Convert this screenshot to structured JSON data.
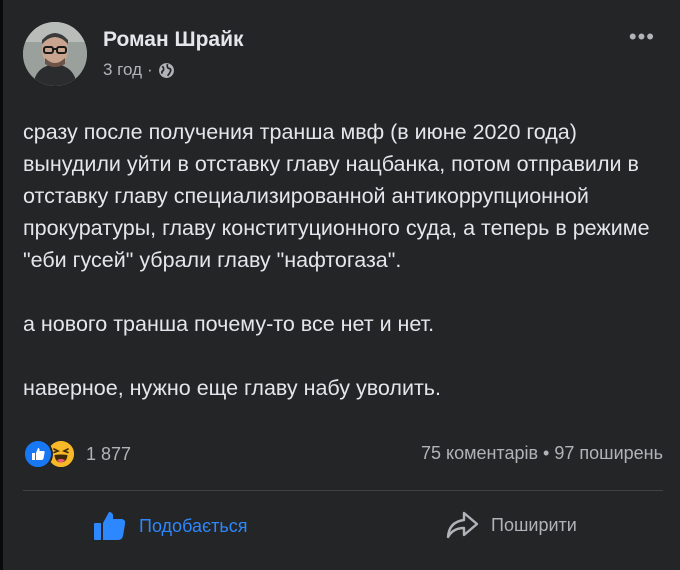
{
  "post": {
    "author": "Роман Шрайк",
    "time": "3 год",
    "separator": "·",
    "menu": "•••",
    "paragraphs": [
      "сразу после получения транша мвф (в июне 2020 года) вынудили уйти в отставку главу нацбанка, потом отправили в отставку главу специализированной антикоррупционной прокуратуры, главу конституционного суда, а теперь в режиме \"еби гусей\" убрали главу \"нафтогаза\".",
      "а нового транша почему-то все нет и нет.",
      "наверное, нужно еще главу набу уволить."
    ],
    "reaction_count": "1 877",
    "comments": "75 коментарів",
    "shares": "97 поширень",
    "stats_separator": "•"
  },
  "actions": {
    "like_label": "Подобається",
    "share_label": "Поширити"
  },
  "icons": {
    "like": "thumbs-up-icon",
    "haha": "laughing-emoji-icon",
    "globe": "globe-icon",
    "share": "share-arrow-icon"
  },
  "colors": {
    "background": "#242526",
    "text": "#e4e6eb",
    "secondary": "#b0b3b8",
    "accent": "#2d88ff",
    "haha": "#f7b928"
  }
}
